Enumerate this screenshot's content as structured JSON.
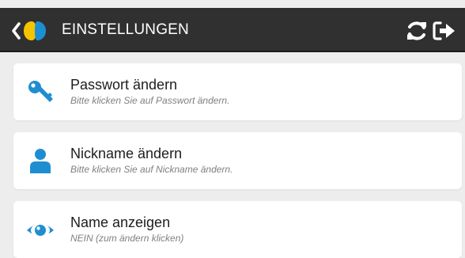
{
  "header": {
    "title": "EINSTELLUNGEN"
  },
  "icons": {
    "back": "chevron-left-icon",
    "logo": "app-logo-icon",
    "refresh": "refresh-icon",
    "logout": "logout-icon"
  },
  "colors": {
    "header_bg": "#303030",
    "icon_blue": "#1f8ed1",
    "logo_yellow": "#f5c400",
    "logo_blue": "#1a8fd3",
    "page_bg": "#ededed"
  },
  "settings": {
    "items": [
      {
        "label": "Passwort ändern",
        "hint": "Bitte klicken Sie auf Passwort ändern.",
        "icon": "key-icon"
      },
      {
        "label": "Nickname ändern",
        "hint": "Bitte klicken Sie auf Nickname ändern.",
        "icon": "user-icon"
      },
      {
        "label": "Name anzeigen",
        "hint": "NEIN (zum ändern klicken)",
        "icon": "eye-icon"
      }
    ]
  }
}
